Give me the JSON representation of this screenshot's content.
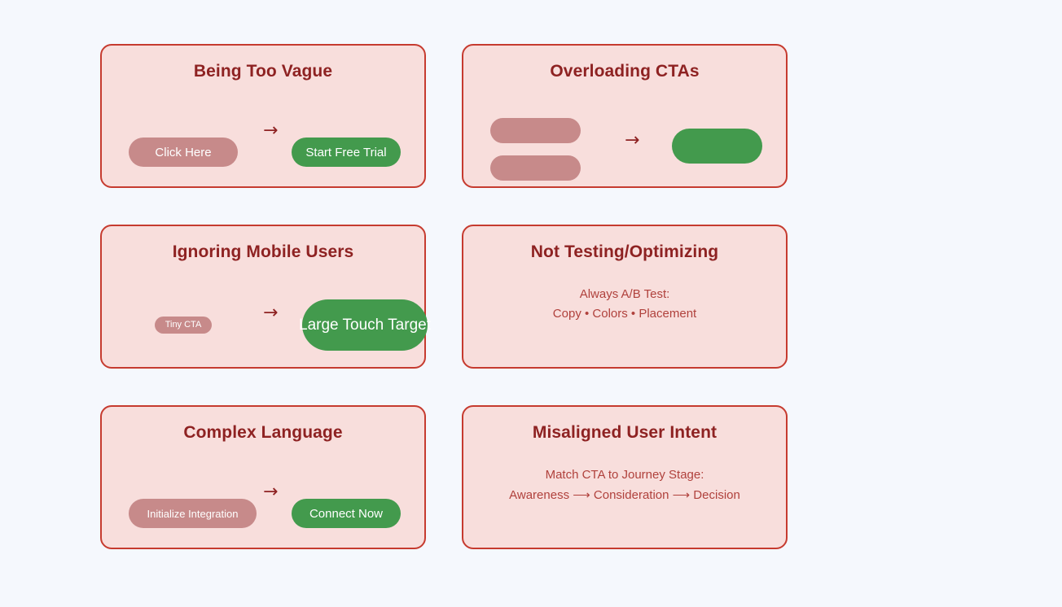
{
  "theme": {
    "page_background": "#f5f8fd",
    "card_background": "#f8dedc",
    "card_border": "#c63b2f",
    "title_color": "#8e2222",
    "body_text_color": "#b0413c",
    "bad_pill_color": "#c78a8a",
    "good_pill_color": "#439a4d",
    "pill_label_color": "#ffffff"
  },
  "cards": [
    {
      "id": "card-1",
      "title": "Being Too Vague",
      "kind": "pill-comparison",
      "arrow": "→",
      "bad_label": "Click Here",
      "good_label": "Start Free Trial"
    },
    {
      "id": "card-2",
      "title": "Overloading CTAs",
      "kind": "pill-comparison-multi",
      "arrow": "→",
      "bad_label_1": "",
      "bad_label_2": "",
      "good_label": ""
    },
    {
      "id": "card-3",
      "title": "Ignoring Mobile Users",
      "kind": "pill-comparison",
      "arrow": "→",
      "bad_label": "Tiny CTA",
      "good_label": "Large Touch Target"
    },
    {
      "id": "card-4",
      "title": "Not Testing/Optimizing",
      "kind": "text",
      "line_1": "Always A/B Test:",
      "line_2": "Copy • Colors • Placement"
    },
    {
      "id": "card-5",
      "title": "Complex Language",
      "kind": "pill-comparison",
      "arrow": "→",
      "bad_label": "Initialize Integration",
      "good_label": "Connect Now"
    },
    {
      "id": "card-6",
      "title": "Misaligned User Intent",
      "kind": "text",
      "line_1": "Match CTA to Journey Stage:",
      "line_2": "Awareness ⟶ Consideration ⟶ Decision"
    }
  ]
}
